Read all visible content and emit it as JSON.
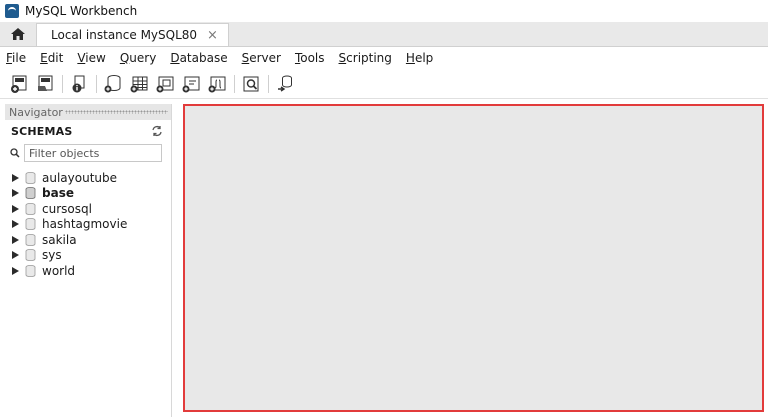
{
  "window": {
    "title": "MySQL Workbench"
  },
  "tabs": {
    "home_icon": "home-icon",
    "connection_label": "Local instance MySQL80",
    "close_glyph": "×"
  },
  "menu": [
    {
      "label": "File",
      "mnemonic": "F",
      "rest": "ile"
    },
    {
      "label": "Edit",
      "mnemonic": "E",
      "rest": "dit"
    },
    {
      "label": "View",
      "mnemonic": "V",
      "rest": "iew"
    },
    {
      "label": "Query",
      "mnemonic": "Q",
      "rest": "uery"
    },
    {
      "label": "Database",
      "mnemonic": "D",
      "rest": "atabase"
    },
    {
      "label": "Server",
      "mnemonic": "S",
      "rest": "erver"
    },
    {
      "label": "Tools",
      "mnemonic": "T",
      "rest": "ools"
    },
    {
      "label": "Scripting",
      "mnemonic": "S",
      "rest": "cripting"
    },
    {
      "label": "Help",
      "mnemonic": "H",
      "rest": "elp"
    }
  ],
  "toolbar": {
    "icons": [
      "new-sql-tab-icon",
      "open-sql-script-icon",
      "inspector-icon",
      "create-schema-icon",
      "create-table-icon",
      "create-view-icon",
      "create-procedure-icon",
      "create-function-icon",
      "search-table-data-icon",
      "reconnect-icon"
    ]
  },
  "navigator": {
    "header": "Navigator",
    "section_title": "SCHEMAS",
    "refresh_icon": "refresh-icon",
    "filter": {
      "placeholder": "Filter objects"
    },
    "schemas": [
      {
        "name": "aulayoutube",
        "bold": false
      },
      {
        "name": "base",
        "bold": true
      },
      {
        "name": "cursosql",
        "bold": false
      },
      {
        "name": "hashtagmovie",
        "bold": false
      },
      {
        "name": "sakila",
        "bold": false
      },
      {
        "name": "sys",
        "bold": false
      },
      {
        "name": "world",
        "bold": false
      }
    ]
  },
  "colors": {
    "accent_border": "#e23b3b",
    "workspace_bg": "#e8e8e8"
  }
}
